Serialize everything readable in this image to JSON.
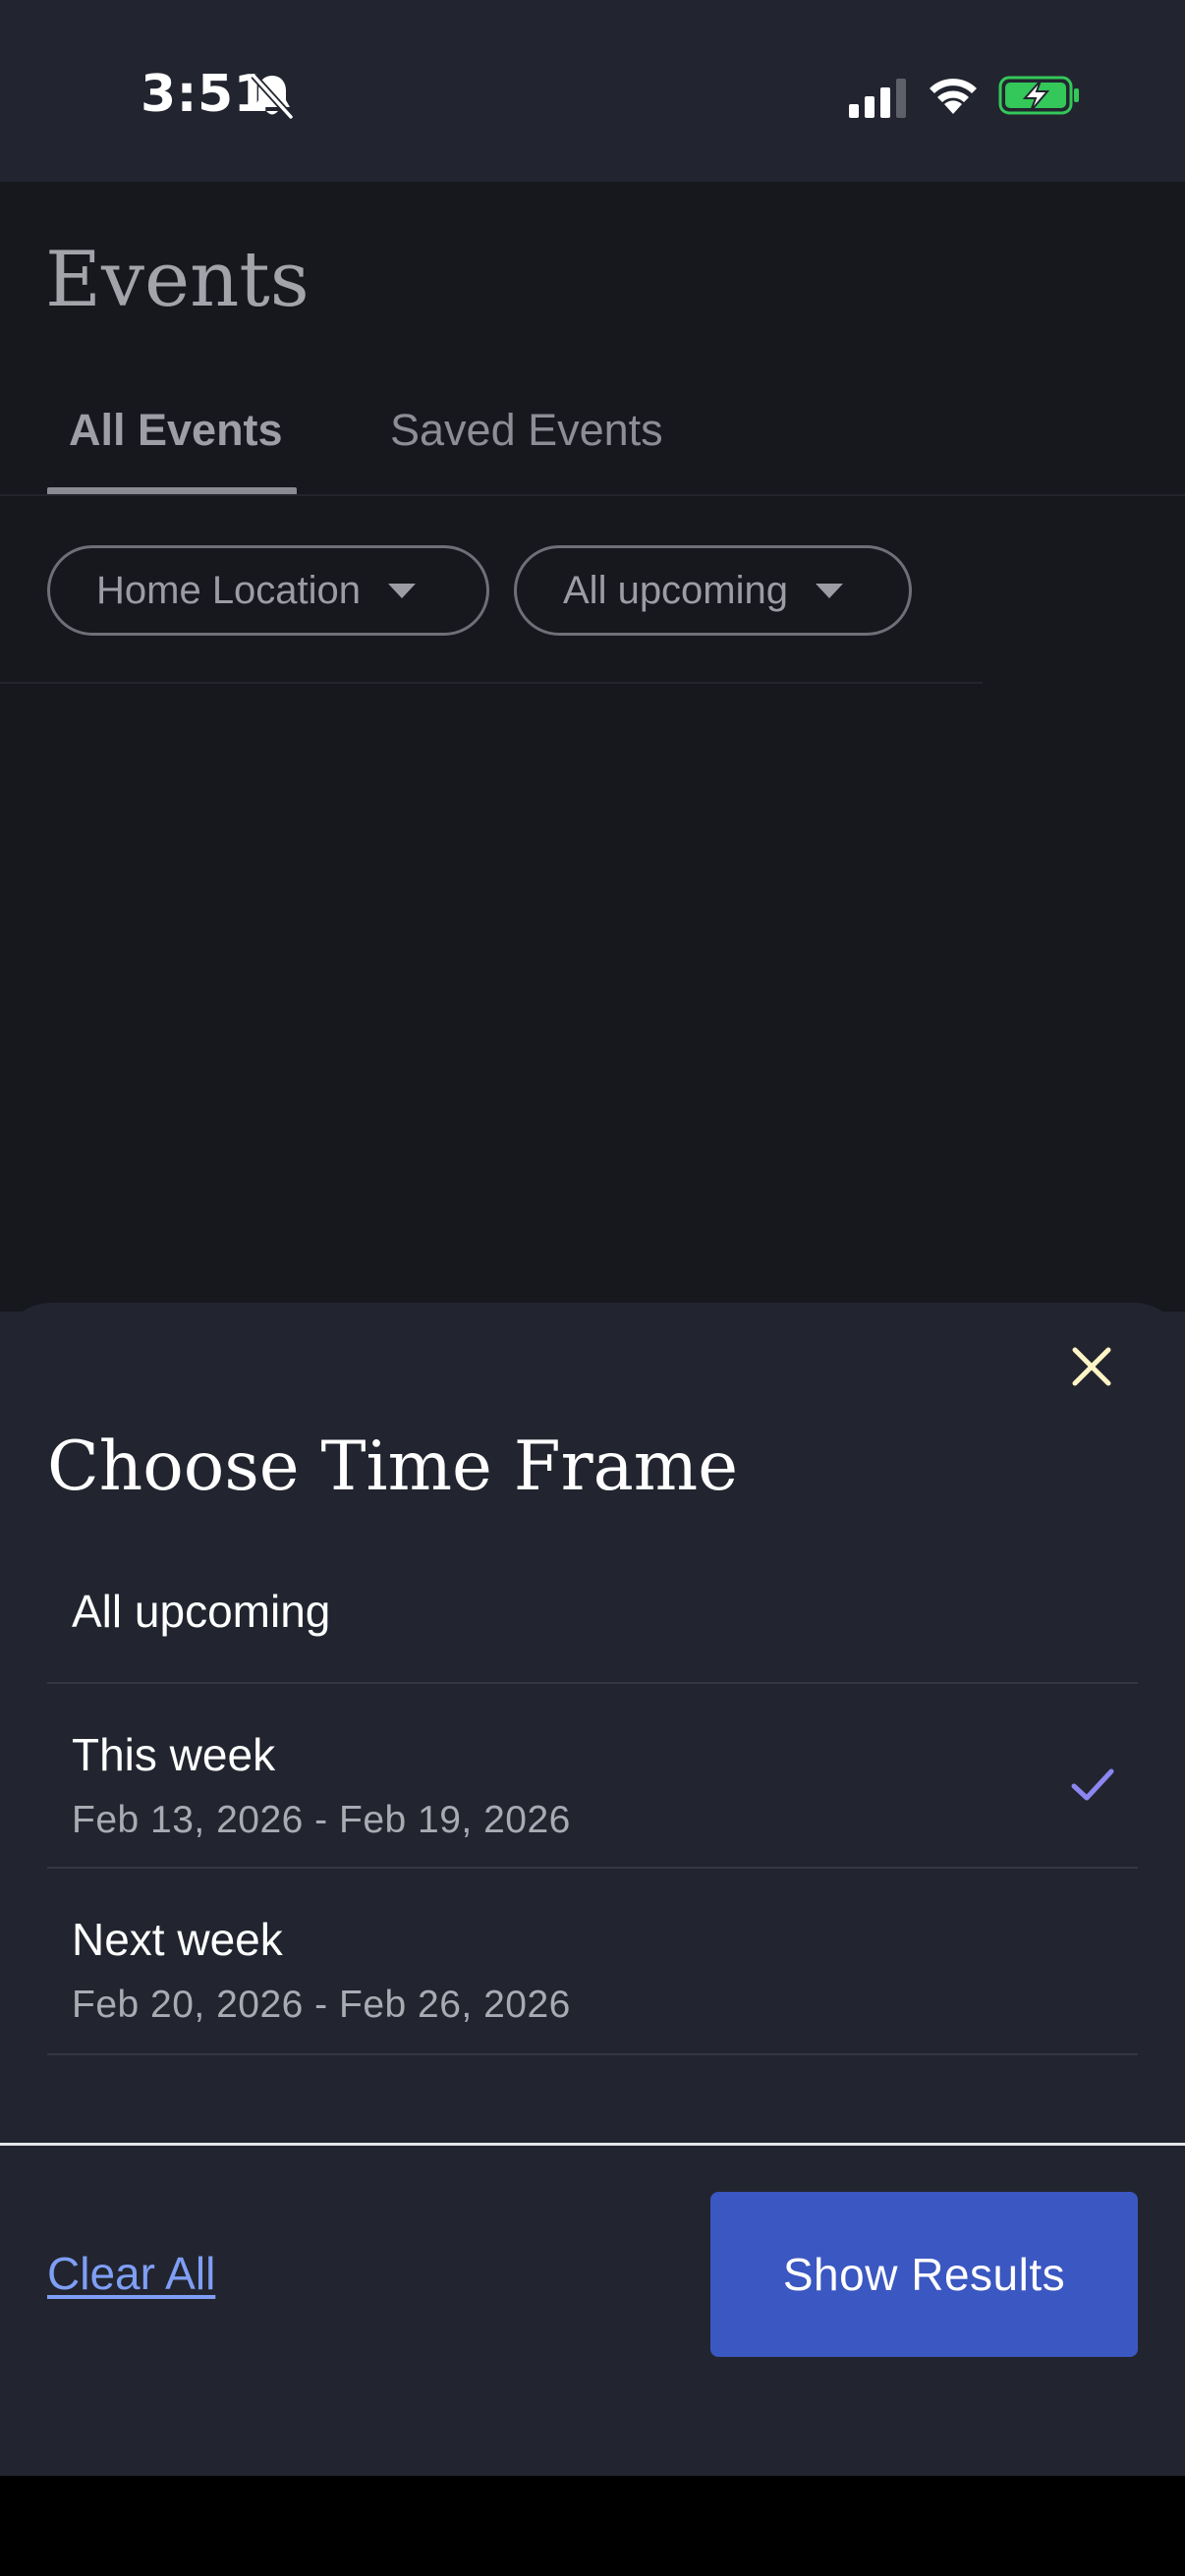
{
  "status_bar": {
    "time": "3:51",
    "icons": [
      "bell-slash-icon",
      "cellular-signal-icon",
      "wifi-icon",
      "battery-charging-icon"
    ]
  },
  "page": {
    "title": "Events",
    "tabs": [
      {
        "label": "All Events",
        "selected": true
      },
      {
        "label": "Saved Events",
        "selected": false
      }
    ],
    "filters": [
      {
        "label": "Home Location"
      },
      {
        "label": "All upcoming"
      }
    ]
  },
  "sheet": {
    "title": "Choose Time Frame",
    "options": [
      {
        "label": "All upcoming",
        "sublabel": "",
        "selected": false
      },
      {
        "label": "This week",
        "sublabel": "Feb 13, 2026 - Feb 19, 2026",
        "selected": true
      },
      {
        "label": "Next week",
        "sublabel": "Feb 20, 2026 - Feb 26, 2026",
        "selected": false
      }
    ],
    "clear_label": "Clear All",
    "submit_label": "Show Results"
  },
  "colors": {
    "sheet_bg": "#22252f",
    "accent_button": "#3b57c1",
    "link": "#7f9ef5",
    "check": "#8b86f0",
    "close": "#fff4c6",
    "battery": "#34c759"
  }
}
